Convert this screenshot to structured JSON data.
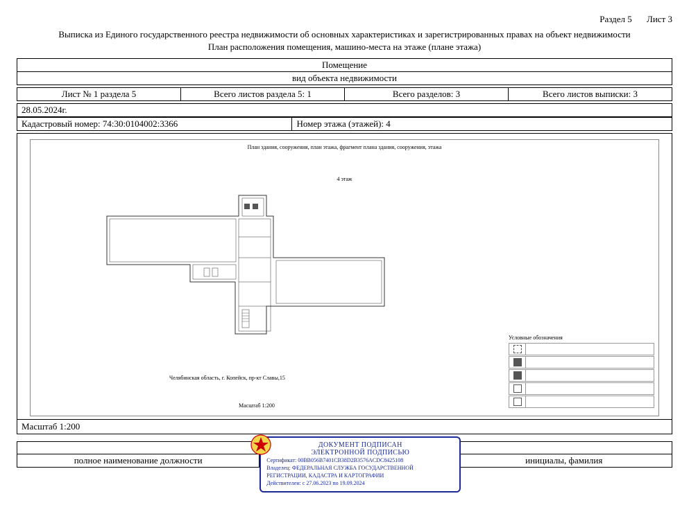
{
  "header": {
    "section": "Раздел 5",
    "sheet": "Лист 3",
    "title1": "Выписка из Единого государственного реестра недвижимости об основных характеристиках и зарегистрированных правах на объект недвижимости",
    "title2": "План расположения помещения, машино-места на этаже (плане этажа)"
  },
  "object_header": {
    "title": "Помещение",
    "subtitle": "вид объекта недвижимости"
  },
  "info_row": {
    "sheet_of_section": "Лист № 1 раздела 5",
    "total_sheets_section": "Всего листов раздела 5: 1",
    "total_sections": "Всего разделов: 3",
    "total_sheets_extract": "Всего листов выписки: 3"
  },
  "date": "28.05.2024г.",
  "cadastre": {
    "label": "Кадастровый номер:",
    "value": "74:30:0104002:3366",
    "floor_label": "Номер этажа (этажей):",
    "floor_value": "4"
  },
  "plan": {
    "caption": "План здания, сооружения, план этажа, фрагмент плана здания, сооружения, этажа",
    "floor": "4 этаж",
    "address": "Челябинская область, г. Копейск, пр-кт Славы,15",
    "scale_inner": "Масштаб 1:200",
    "legend_title": "Условные обозначения"
  },
  "scale_row": "Масштаб 1:200",
  "signature": {
    "position_label": "полное наименование должности",
    "initials_label": "инициалы, фамилия"
  },
  "stamp": {
    "l1": "ДОКУМЕНТ ПОДПИСАН",
    "l2": "ЭЛЕКТРОННОЙ ПОДПИСЬЮ",
    "cert": "Сертификат: 00BB056B7401CB38D2B3576ACDC8425108",
    "owner": "Владелец: ФЕДЕРАЛЬНАЯ СЛУЖБА ГОСУДАРСТВЕННОЙ РЕГИСТРАЦИИ, КАДАСТРА И КАРТОГРАФИИ",
    "valid": "Действителен: с 27.06.2023 по 19.09.2024"
  }
}
